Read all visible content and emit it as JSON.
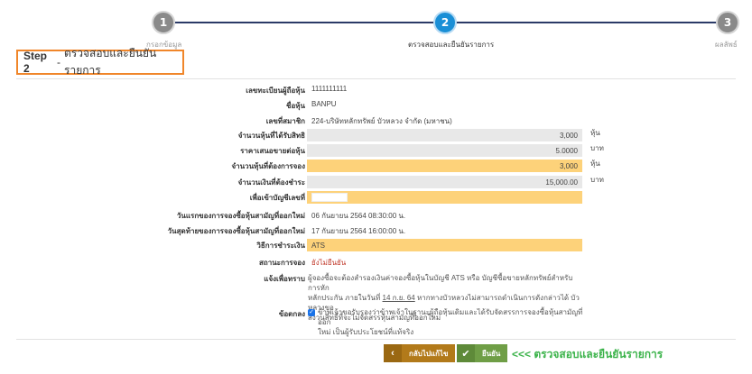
{
  "stepper": {
    "steps": [
      {
        "number": "1",
        "label": "กรอกข้อมูล"
      },
      {
        "number": "2",
        "label": "ตรวจสอบและยืนยันรายการ"
      },
      {
        "number": "3",
        "label": "ผลลัพธ์"
      }
    ],
    "active_index": 1
  },
  "step_title": {
    "step": "Step 2",
    "separator": "-",
    "text": "ตรวจสอบและยืนยันรายการ"
  },
  "form": {
    "registration_no": {
      "label": "เลขทะเบียนผู้ถือหุ้น",
      "value": "1111111111"
    },
    "stock_name": {
      "label": "ชื่อหุ้น",
      "value": "BANPU"
    },
    "member_no": {
      "label": "เลขที่สมาชิก",
      "value": "224-บริษัทหลักทรัพย์ บัวหลวง จำกัด (มหาชน)"
    },
    "rights_shares": {
      "label": "จำนวนหุ้นที่ได้รับสิทธิ",
      "value": "3,000",
      "unit": "หุ้น"
    },
    "offer_price": {
      "label": "ราคาเสนอขายต่อหุ้น",
      "value": "5.0000",
      "unit": "บาท"
    },
    "subscribe_shares": {
      "label": "จำนวนหุ้นที่ต้องการจอง",
      "value": "3,000",
      "unit": "หุ้น"
    },
    "amount_payable": {
      "label": "จำนวนเงินที่ต้องชำระ",
      "value": "15,000.00",
      "unit": "บาท"
    },
    "account_no": {
      "label": "เพื่อเข้าบัญชีเลขที่",
      "value": ""
    },
    "start_date": {
      "label": "วันแรกของการจองซื้อหุ้นสามัญที่ออกใหม่",
      "value": "06 กันยายน 2564 08:30:00 น."
    },
    "end_date": {
      "label": "วันสุดท้ายของการจองซื้อหุ้นสามัญที่ออกใหม่",
      "value": "17 กันยายน 2564 16:00:00 น."
    },
    "payment_method": {
      "label": "วิธีการชำระเงิน",
      "value": "ATS"
    },
    "status": {
      "label": "สถานะการจอง",
      "value": "ยังไม่ยืนยัน"
    },
    "notice": {
      "label": "แจ้งเพื่อทราบ",
      "line1": "ผู้จองซื้อจะต้องสำรองเงินค่าจองซื้อหุ้นในบัญชี ATS หรือ บัญชีซื้อขายหลักทรัพย์สำหรับการหัก",
      "line2_pre": "หลักประกัน ภายในวันที่",
      "line2_date": "14 ก.ย. 64",
      "line2_post": "หากทางบัวหลวงไม่สามารถดำเนินการดังกล่าวได้ บัวหลวงขอ",
      "line3": "สงวนสิทธิ์ที่จะไม่จัดสรรหุ้นสามัญที่ออกใหม่"
    },
    "agreement": {
      "label": "ข้อตกลง",
      "line1": "ข้าพเจ้าขอรับรองว่าข้าพเจ้าในฐานะผู้ถือหุ้นเดิมและได้รับจัดสรรการจองซื้อหุ้นสามัญที่ออก",
      "line2": "ใหม่ เป็นผู้รับประโยชน์ที่แท้จริง",
      "checked": true
    }
  },
  "buttons": {
    "back": {
      "label": "กลับไปแก้ไข",
      "icon": "chevron-left-icon"
    },
    "confirm": {
      "label": "ยืนยัน",
      "icon": "check-icon"
    }
  },
  "hint_text": "<<< ตรวจสอบและยืนยันรายการ",
  "colors": {
    "accent_orange": "#f0862a",
    "active_step": "#1a8fd6",
    "highlight_yellow": "#fdd27a",
    "confirm_green": "#6f9e46",
    "back_brown": "#b27a1a",
    "hint_green": "#3bb34a"
  }
}
